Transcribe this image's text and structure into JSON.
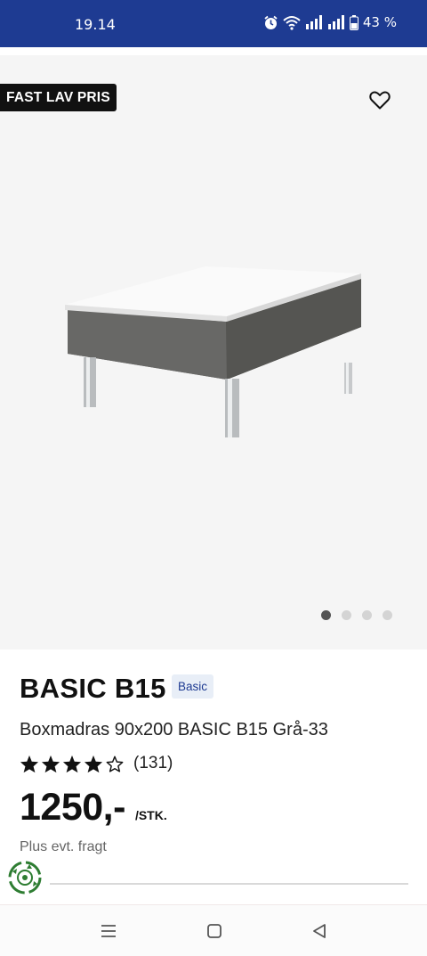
{
  "status_bar": {
    "time": "19.14",
    "battery_label": "43 %",
    "icons": [
      "alarm-icon",
      "wifi-icon",
      "signal-icon",
      "signal-icon",
      "battery-icon"
    ],
    "background_color": "#1e3b92"
  },
  "gallery": {
    "promo_badge": "FAST LAV PRIS",
    "image_alt": "Boxmadras 90x200 BASIC B15 Grå-33",
    "slide_count": 4,
    "active_slide": 1
  },
  "product": {
    "name": "BASIC B15",
    "brand_badge": "Basic",
    "description": "Boxmadras 90x200 BASIC B15 Grå-33",
    "rating": 4,
    "rating_max": 5,
    "review_count": "(131)",
    "price": "1250,-",
    "unit": "/STK.",
    "shipping_note": "Plus evt. fragt"
  },
  "nav_bar": {
    "buttons": [
      "recent-apps",
      "home",
      "back"
    ]
  }
}
